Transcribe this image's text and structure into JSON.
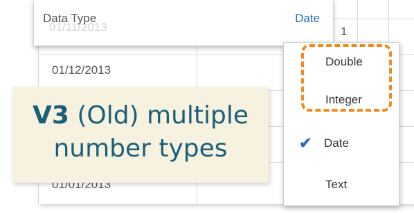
{
  "header": {
    "label": "Data Type",
    "value": "Date"
  },
  "grid": {
    "rows": [
      "01/11/2013",
      "01/12/2013",
      "01/01/2013"
    ],
    "col2_first": "1"
  },
  "menu": {
    "items": [
      {
        "label": "Double",
        "checked": false
      },
      {
        "label": "Integer",
        "checked": false
      },
      {
        "label": "Date",
        "checked": true
      },
      {
        "label": "Text",
        "checked": false
      }
    ],
    "check_glyph": "✔",
    "highlight_color": "#f28a1e"
  },
  "caption": {
    "bold": "V3",
    "rest_line1": " (Old) multiple",
    "line2": "number types"
  },
  "colors": {
    "accent": "#2a6cc0",
    "caption_text": "#1a5f7a",
    "caption_bg": "#f7f2df"
  }
}
